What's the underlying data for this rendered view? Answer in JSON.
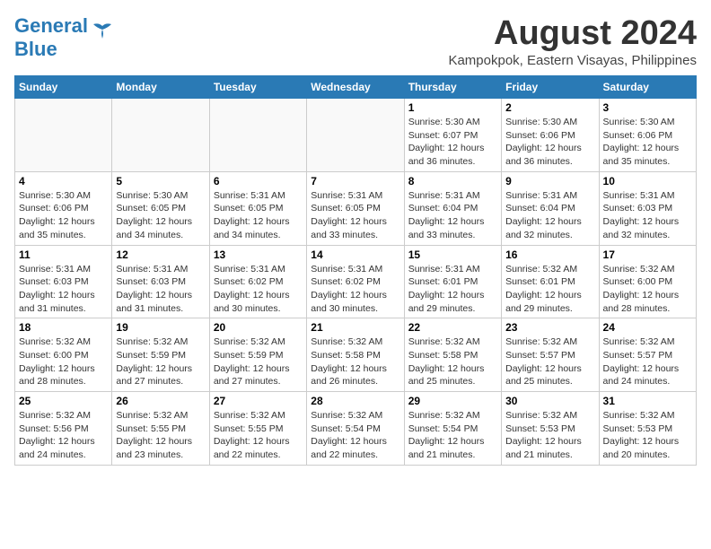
{
  "header": {
    "logo_line1": "General",
    "logo_line2": "Blue",
    "month_year": "August 2024",
    "location": "Kampokpok, Eastern Visayas, Philippines"
  },
  "days_of_week": [
    "Sunday",
    "Monday",
    "Tuesday",
    "Wednesday",
    "Thursday",
    "Friday",
    "Saturday"
  ],
  "weeks": [
    [
      {
        "day": "",
        "sunrise": "",
        "sunset": "",
        "daylight": ""
      },
      {
        "day": "",
        "sunrise": "",
        "sunset": "",
        "daylight": ""
      },
      {
        "day": "",
        "sunrise": "",
        "sunset": "",
        "daylight": ""
      },
      {
        "day": "",
        "sunrise": "",
        "sunset": "",
        "daylight": ""
      },
      {
        "day": "1",
        "sunrise": "Sunrise: 5:30 AM",
        "sunset": "Sunset: 6:07 PM",
        "daylight": "Daylight: 12 hours and 36 minutes."
      },
      {
        "day": "2",
        "sunrise": "Sunrise: 5:30 AM",
        "sunset": "Sunset: 6:06 PM",
        "daylight": "Daylight: 12 hours and 36 minutes."
      },
      {
        "day": "3",
        "sunrise": "Sunrise: 5:30 AM",
        "sunset": "Sunset: 6:06 PM",
        "daylight": "Daylight: 12 hours and 35 minutes."
      }
    ],
    [
      {
        "day": "4",
        "sunrise": "Sunrise: 5:30 AM",
        "sunset": "Sunset: 6:06 PM",
        "daylight": "Daylight: 12 hours and 35 minutes."
      },
      {
        "day": "5",
        "sunrise": "Sunrise: 5:30 AM",
        "sunset": "Sunset: 6:05 PM",
        "daylight": "Daylight: 12 hours and 34 minutes."
      },
      {
        "day": "6",
        "sunrise": "Sunrise: 5:31 AM",
        "sunset": "Sunset: 6:05 PM",
        "daylight": "Daylight: 12 hours and 34 minutes."
      },
      {
        "day": "7",
        "sunrise": "Sunrise: 5:31 AM",
        "sunset": "Sunset: 6:05 PM",
        "daylight": "Daylight: 12 hours and 33 minutes."
      },
      {
        "day": "8",
        "sunrise": "Sunrise: 5:31 AM",
        "sunset": "Sunset: 6:04 PM",
        "daylight": "Daylight: 12 hours and 33 minutes."
      },
      {
        "day": "9",
        "sunrise": "Sunrise: 5:31 AM",
        "sunset": "Sunset: 6:04 PM",
        "daylight": "Daylight: 12 hours and 32 minutes."
      },
      {
        "day": "10",
        "sunrise": "Sunrise: 5:31 AM",
        "sunset": "Sunset: 6:03 PM",
        "daylight": "Daylight: 12 hours and 32 minutes."
      }
    ],
    [
      {
        "day": "11",
        "sunrise": "Sunrise: 5:31 AM",
        "sunset": "Sunset: 6:03 PM",
        "daylight": "Daylight: 12 hours and 31 minutes."
      },
      {
        "day": "12",
        "sunrise": "Sunrise: 5:31 AM",
        "sunset": "Sunset: 6:03 PM",
        "daylight": "Daylight: 12 hours and 31 minutes."
      },
      {
        "day": "13",
        "sunrise": "Sunrise: 5:31 AM",
        "sunset": "Sunset: 6:02 PM",
        "daylight": "Daylight: 12 hours and 30 minutes."
      },
      {
        "day": "14",
        "sunrise": "Sunrise: 5:31 AM",
        "sunset": "Sunset: 6:02 PM",
        "daylight": "Daylight: 12 hours and 30 minutes."
      },
      {
        "day": "15",
        "sunrise": "Sunrise: 5:31 AM",
        "sunset": "Sunset: 6:01 PM",
        "daylight": "Daylight: 12 hours and 29 minutes."
      },
      {
        "day": "16",
        "sunrise": "Sunrise: 5:32 AM",
        "sunset": "Sunset: 6:01 PM",
        "daylight": "Daylight: 12 hours and 29 minutes."
      },
      {
        "day": "17",
        "sunrise": "Sunrise: 5:32 AM",
        "sunset": "Sunset: 6:00 PM",
        "daylight": "Daylight: 12 hours and 28 minutes."
      }
    ],
    [
      {
        "day": "18",
        "sunrise": "Sunrise: 5:32 AM",
        "sunset": "Sunset: 6:00 PM",
        "daylight": "Daylight: 12 hours and 28 minutes."
      },
      {
        "day": "19",
        "sunrise": "Sunrise: 5:32 AM",
        "sunset": "Sunset: 5:59 PM",
        "daylight": "Daylight: 12 hours and 27 minutes."
      },
      {
        "day": "20",
        "sunrise": "Sunrise: 5:32 AM",
        "sunset": "Sunset: 5:59 PM",
        "daylight": "Daylight: 12 hours and 27 minutes."
      },
      {
        "day": "21",
        "sunrise": "Sunrise: 5:32 AM",
        "sunset": "Sunset: 5:58 PM",
        "daylight": "Daylight: 12 hours and 26 minutes."
      },
      {
        "day": "22",
        "sunrise": "Sunrise: 5:32 AM",
        "sunset": "Sunset: 5:58 PM",
        "daylight": "Daylight: 12 hours and 25 minutes."
      },
      {
        "day": "23",
        "sunrise": "Sunrise: 5:32 AM",
        "sunset": "Sunset: 5:57 PM",
        "daylight": "Daylight: 12 hours and 25 minutes."
      },
      {
        "day": "24",
        "sunrise": "Sunrise: 5:32 AM",
        "sunset": "Sunset: 5:57 PM",
        "daylight": "Daylight: 12 hours and 24 minutes."
      }
    ],
    [
      {
        "day": "25",
        "sunrise": "Sunrise: 5:32 AM",
        "sunset": "Sunset: 5:56 PM",
        "daylight": "Daylight: 12 hours and 24 minutes."
      },
      {
        "day": "26",
        "sunrise": "Sunrise: 5:32 AM",
        "sunset": "Sunset: 5:55 PM",
        "daylight": "Daylight: 12 hours and 23 minutes."
      },
      {
        "day": "27",
        "sunrise": "Sunrise: 5:32 AM",
        "sunset": "Sunset: 5:55 PM",
        "daylight": "Daylight: 12 hours and 22 minutes."
      },
      {
        "day": "28",
        "sunrise": "Sunrise: 5:32 AM",
        "sunset": "Sunset: 5:54 PM",
        "daylight": "Daylight: 12 hours and 22 minutes."
      },
      {
        "day": "29",
        "sunrise": "Sunrise: 5:32 AM",
        "sunset": "Sunset: 5:54 PM",
        "daylight": "Daylight: 12 hours and 21 minutes."
      },
      {
        "day": "30",
        "sunrise": "Sunrise: 5:32 AM",
        "sunset": "Sunset: 5:53 PM",
        "daylight": "Daylight: 12 hours and 21 minutes."
      },
      {
        "day": "31",
        "sunrise": "Sunrise: 5:32 AM",
        "sunset": "Sunset: 5:53 PM",
        "daylight": "Daylight: 12 hours and 20 minutes."
      }
    ]
  ]
}
